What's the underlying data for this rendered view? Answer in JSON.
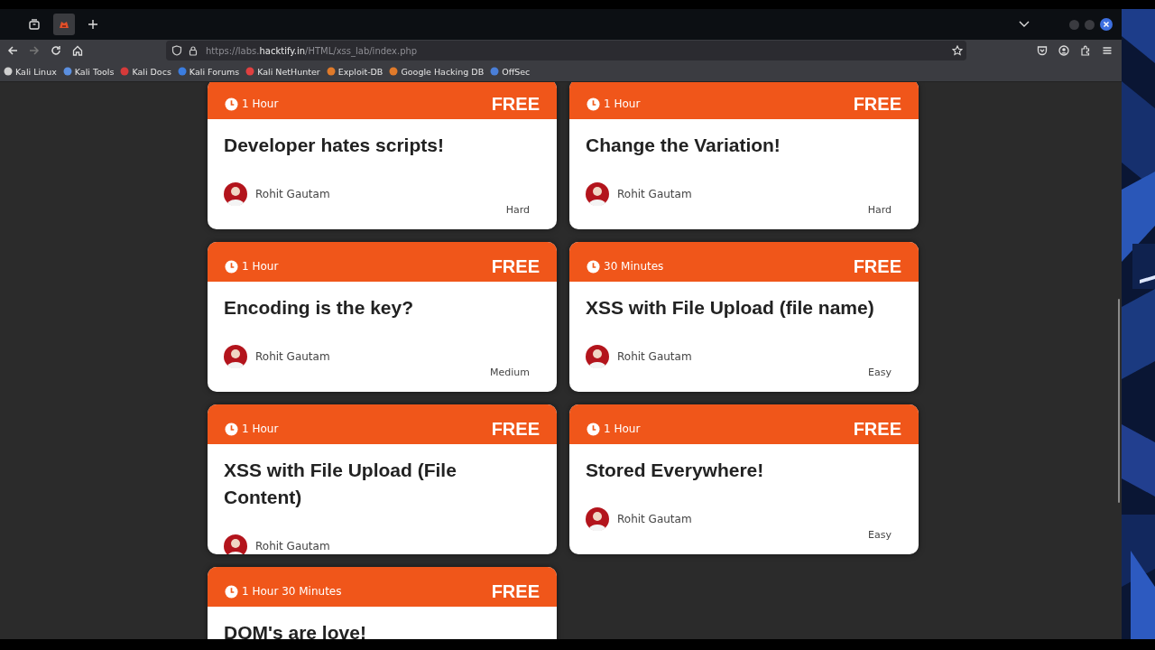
{
  "browser": {
    "address_bar": {
      "url_parts": [
        {
          "text": "https://labs.",
          "highlighted": false
        },
        {
          "text": "hacktify.in",
          "highlighted": true
        },
        {
          "text": "/HTML/xss_lab/index.php",
          "highlighted": false
        }
      ]
    },
    "bookmarks": [
      {
        "label": "Kali Linux",
        "color": "#cfcfcf"
      },
      {
        "label": "Kali Tools",
        "color": "#5b8fe0"
      },
      {
        "label": "Kali Docs",
        "color": "#d63a3a"
      },
      {
        "label": "Kali Forums",
        "color": "#3b7de0"
      },
      {
        "label": "Kali NetHunter",
        "color": "#e04040"
      },
      {
        "label": "Exploit-DB",
        "color": "#e07a2a"
      },
      {
        "label": "Google Hacking DB",
        "color": "#e07a2a"
      },
      {
        "label": "OffSec",
        "color": "#4a7fd8"
      }
    ]
  },
  "cards": [
    {
      "duration": "1 Hour",
      "price": "FREE",
      "title": "Developer hates scripts!",
      "author": "Rohit Gautam",
      "difficulty": "Hard"
    },
    {
      "duration": "1 Hour",
      "price": "FREE",
      "title": "Change the Variation!",
      "author": "Rohit Gautam",
      "difficulty": "Hard"
    },
    {
      "duration": "1 Hour",
      "price": "FREE",
      "title": "Encoding is the key?",
      "author": "Rohit Gautam",
      "difficulty": "Medium"
    },
    {
      "duration": "30 Minutes",
      "price": "FREE",
      "title": "XSS with File Upload (file name)",
      "author": "Rohit Gautam",
      "difficulty": "Easy"
    },
    {
      "duration": "1 Hour",
      "price": "FREE",
      "title": "XSS with File Upload (File Content)",
      "author": "Rohit Gautam"
    },
    {
      "duration": "1 Hour",
      "price": "FREE",
      "title": "Stored Everywhere!",
      "author": "Rohit Gautam",
      "difficulty": "Easy"
    },
    {
      "duration": "1 Hour 30 Minutes",
      "price": "FREE",
      "title": "DOM's are love!"
    }
  ]
}
